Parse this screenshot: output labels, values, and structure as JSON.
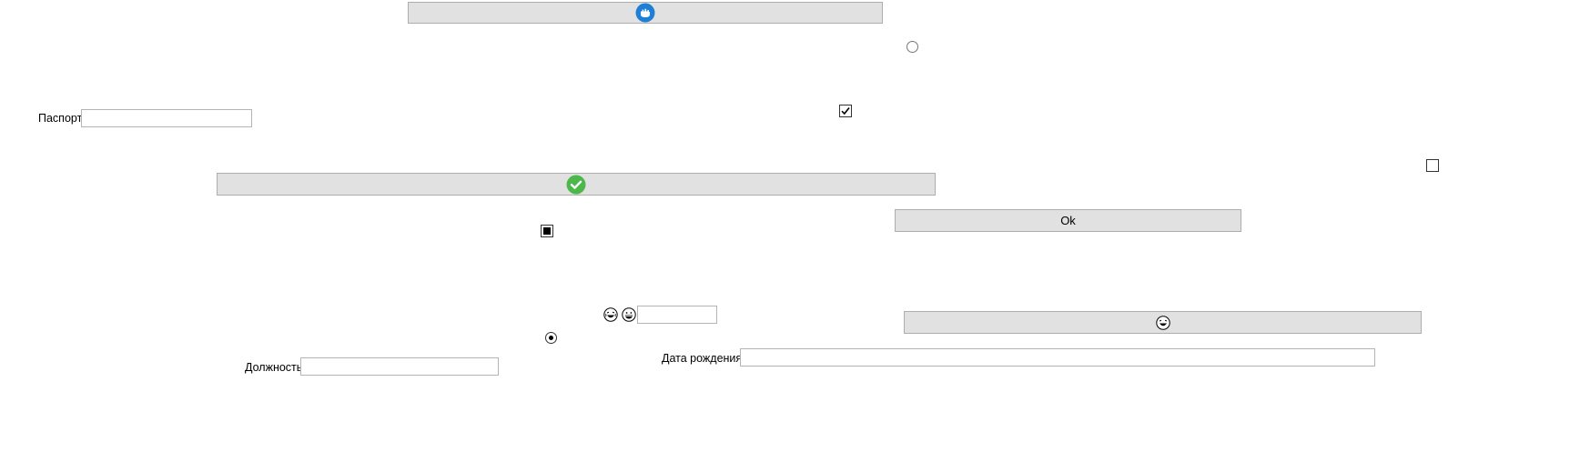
{
  "buttons": {
    "top": {
      "icon": "blue-circle-icon",
      "accent": "#1e7fd6"
    },
    "check": {
      "icon": "green-check-icon",
      "accent": "#4cb84c"
    },
    "ok": {
      "label": "Ok"
    },
    "emoji": {
      "icon": "laughing-face-icon"
    }
  },
  "fields": {
    "passport": {
      "label": "Паспорт",
      "value": ""
    },
    "position": {
      "label": "Должность",
      "value": ""
    },
    "birth_date": {
      "label": "Дата рождения",
      "value": ""
    },
    "emoji_field": {
      "value": ""
    }
  },
  "checkboxes": {
    "first": {
      "state": "checked"
    },
    "second": {
      "state": "unchecked"
    },
    "third": {
      "state": "indeterminate"
    }
  },
  "radios": {
    "first": {
      "state": "unchecked"
    },
    "second": {
      "state": "checked"
    }
  },
  "emojis": {
    "left": "laughing-face-icon",
    "right": "grinning-face-icon"
  },
  "colors": {
    "button_bg": "#e1e1e1",
    "button_border": "#adadad",
    "field_border": "#b4b4b4"
  }
}
